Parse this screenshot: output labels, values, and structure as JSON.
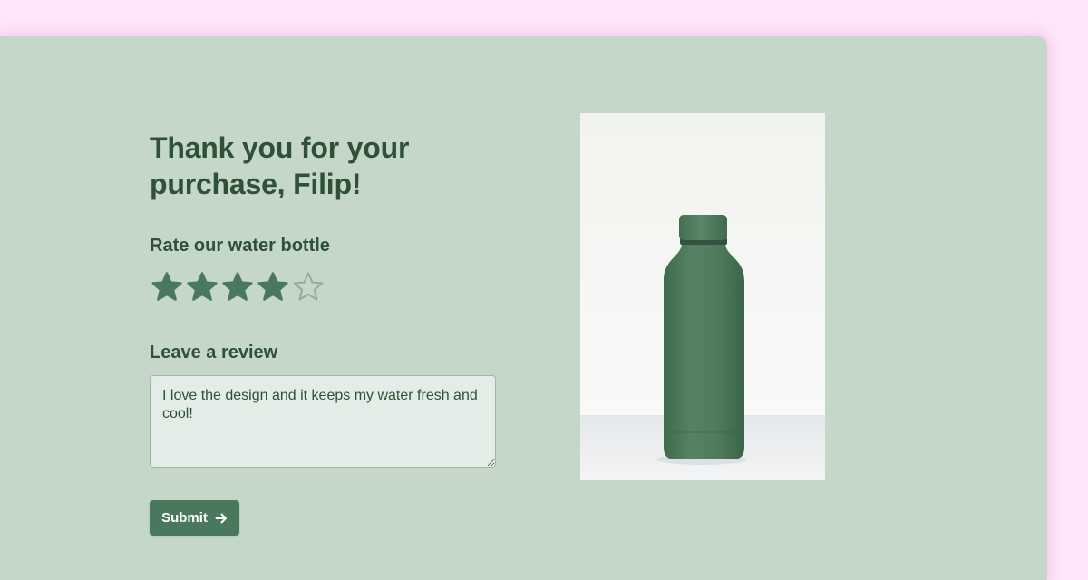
{
  "heading": {
    "line1": "Thank you for your",
    "line2": "purchase, Filip!"
  },
  "rating": {
    "label": "Rate our water bottle",
    "value": 4,
    "max": 5,
    "filled_color": "#4a785c",
    "empty_color": "#8fae99"
  },
  "review": {
    "label": "Leave a review",
    "value": "I love the design and it keeps my water fresh and cool!"
  },
  "submit": {
    "label": "Submit",
    "icon": "arrow-right-icon"
  },
  "product_image": {
    "subject": "green-water-bottle",
    "bottle_color": "#4d7a5a"
  },
  "colors": {
    "page_background": "#ffe6fb",
    "card_background": "#c4d7c9",
    "text": "#2e5138",
    "accent": "#4a785c"
  }
}
